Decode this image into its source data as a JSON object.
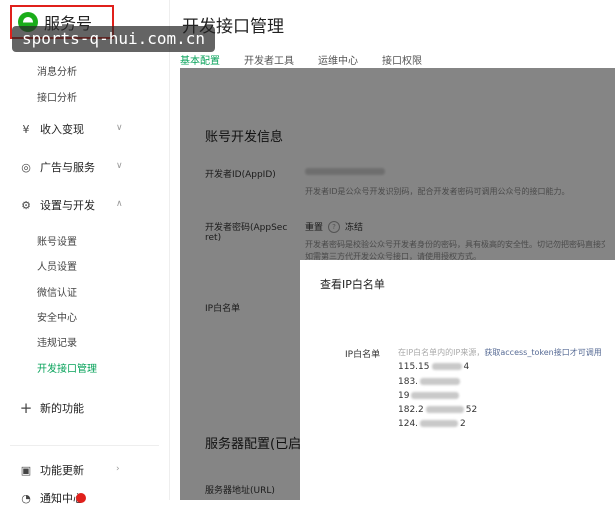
{
  "brand": {
    "name": "服务号"
  },
  "watermark": "sports-q-hui.com.cn",
  "sidebar": {
    "stats_items": [
      {
        "label": "消息分析"
      },
      {
        "label": "接口分析"
      }
    ],
    "groups": [
      {
        "label": "收入变现",
        "icon": "yen-icon"
      },
      {
        "label": "广告与服务",
        "icon": "compass-icon"
      },
      {
        "label": "设置与开发",
        "icon": "gear-icon"
      }
    ],
    "dev_items": [
      {
        "label": "账号设置"
      },
      {
        "label": "人员设置"
      },
      {
        "label": "微信认证"
      },
      {
        "label": "安全中心"
      },
      {
        "label": "违规记录"
      },
      {
        "label": "开发接口管理"
      }
    ],
    "new_feature": {
      "label": "新的功能"
    },
    "feature_update": {
      "label": "功能更新"
    },
    "bottom_item": {
      "label": "通知中心"
    }
  },
  "main": {
    "title": "开发接口管理",
    "tabs": [
      {
        "label": "基本配置"
      },
      {
        "label": "开发者工具"
      },
      {
        "label": "运维中心"
      },
      {
        "label": "接口权限"
      }
    ],
    "account_section": {
      "title": "账号开发信息",
      "appid_label": "开发者ID(AppID)",
      "appid_desc": "开发者ID是公众号开发识别码，配合开发者密码可调用公众号的接口能力。",
      "secret_label_1": "开发者密码(AppSec",
      "secret_label_2": "ret)",
      "secret_reset": "重置",
      "secret_freeze": "冻结",
      "secret_desc_1": "开发者密码是校验公众号开发者身份的密码，具有极高的安全性。切记勿把密码直接交给第三方开发者或直接存储在代码中。",
      "secret_desc_2": "如需第三方代开发公众号接口，请使用授权方式。",
      "ip_label": "IP白名单"
    },
    "server_section": {
      "title": "服务器配置(已启用)",
      "url_label": "服务器地址(URL)"
    }
  },
  "modal": {
    "title": "查看IP白名单",
    "label": "IP白名单",
    "desc_prefix": "在IP白名单内的IP来源，",
    "desc_link": "获取access_token接口才可调用",
    "ips": [
      {
        "head": "115.15",
        "tail": "4"
      },
      {
        "head": "183.",
        "tail": ""
      },
      {
        "head": "19",
        "tail": ""
      },
      {
        "head": "182.2",
        "tail": "52"
      },
      {
        "head": "124.",
        "tail": "2"
      }
    ]
  }
}
